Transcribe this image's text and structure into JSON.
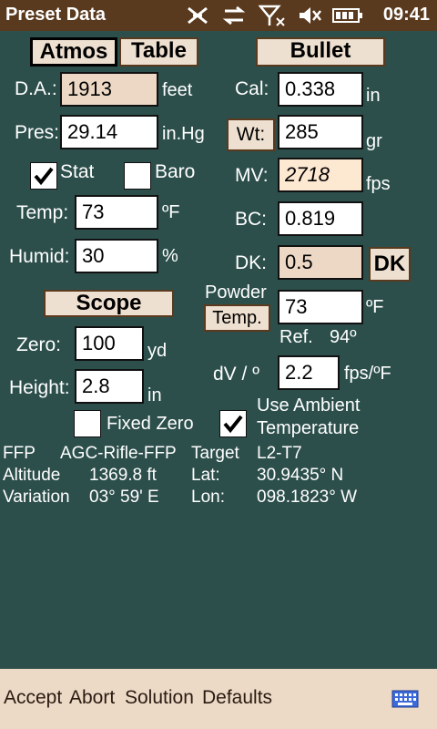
{
  "status": {
    "title": "Preset Data",
    "time": "09:41",
    "icons": [
      "sync-off-icon",
      "transfer-icon",
      "signal-off-icon",
      "volume-mute-icon",
      "battery-icon"
    ]
  },
  "atmos": {
    "tab_atmos": "Atmos",
    "tab_table": "Table",
    "da_label": "D.A.:",
    "da_value": "1913",
    "da_unit": "feet",
    "pres_label": "Pres:",
    "pres_value": "29.14",
    "pres_unit": "in.Hg",
    "stat_label": "Stat",
    "stat_checked": true,
    "baro_label": "Baro",
    "baro_checked": false,
    "temp_label": "Temp:",
    "temp_value": "73",
    "temp_unit": "ºF",
    "humid_label": "Humid:",
    "humid_value": "30",
    "humid_unit": "%"
  },
  "bullet": {
    "header": "Bullet",
    "cal_label": "Cal:",
    "cal_value": "0.338",
    "cal_unit": "in",
    "wt_label": "Wt:",
    "wt_value": "285",
    "wt_unit": "gr",
    "mv_label": "MV:",
    "mv_value": "2718",
    "mv_unit": "fps",
    "bc_label": "BC:",
    "bc_value": "0.819",
    "dk_label": "DK:",
    "dk_value": "0.5",
    "dk_button": "DK",
    "powder_label": "Powder",
    "powder_temp_button": "Temp.",
    "powder_value": "73",
    "powder_unit": "ºF",
    "ref_label": "Ref.",
    "ref_value": "94º",
    "dv_label": "dV / º",
    "dv_value": "2.2",
    "dv_unit": "fps/ºF",
    "use_ambient_line1": "Use Ambient",
    "use_ambient_line2": "Temperature",
    "use_ambient_checked": true
  },
  "scope": {
    "header": "Scope",
    "zero_label": "Zero:",
    "zero_value": "100",
    "zero_unit": "yd",
    "height_label": "Height:",
    "height_value": "2.8",
    "height_unit": "in",
    "fixed_zero_label": "Fixed Zero",
    "fixed_zero_checked": false
  },
  "info": {
    "row1": [
      "FFP",
      "AGC-Rifle-FFP",
      "Target",
      "L2-T7"
    ],
    "row2": [
      "Altitude",
      "1369.8 ft",
      "Lat:",
      "30.9435° N"
    ],
    "row3": [
      "Variation",
      "03° 59' E",
      "Lon:",
      "098.1823° W"
    ]
  },
  "menu": {
    "accept": "Accept",
    "abort": "Abort",
    "solution": "Solution",
    "defaults": "Defaults",
    "keyboard_icon": "keyboard-icon"
  },
  "colors": {
    "background": "#2c4f4c",
    "titlebar": "#5a3a1e",
    "menubar": "#ecdac7",
    "field_readonly": "#ecd8c5"
  }
}
